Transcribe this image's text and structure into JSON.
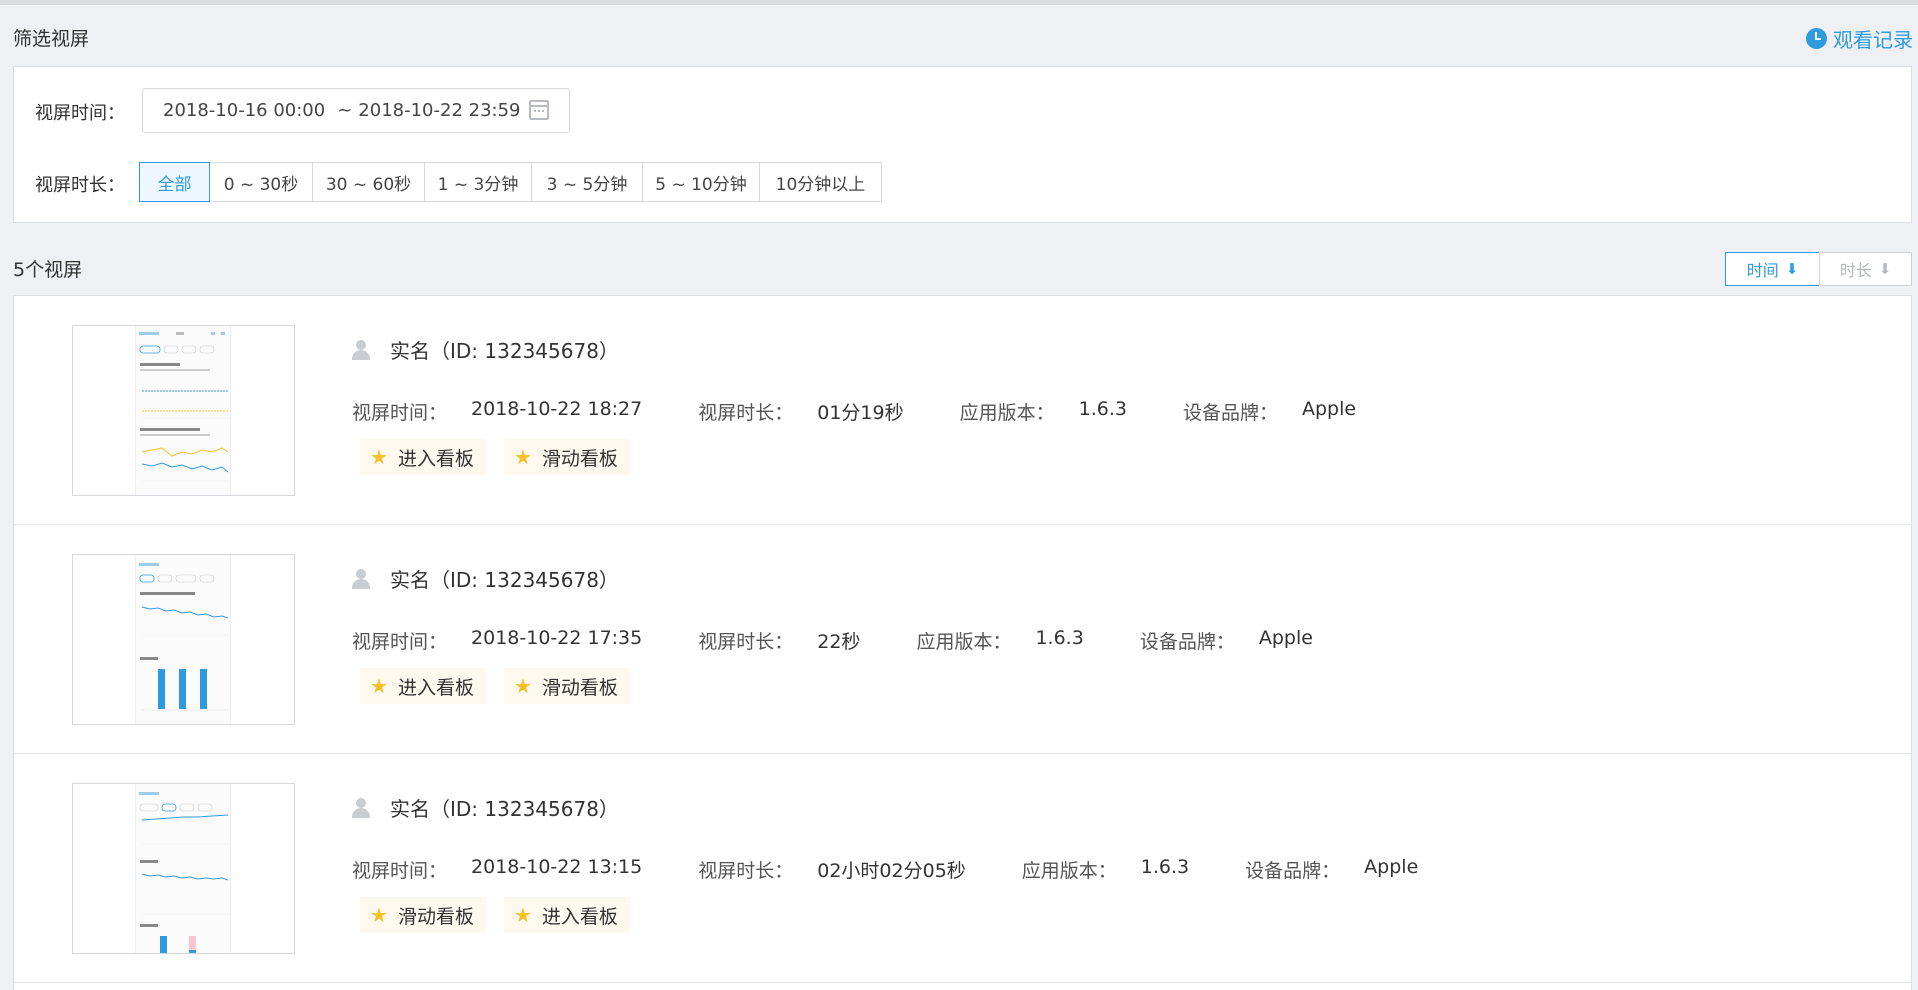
{
  "filter": {
    "title": "筛选视屏",
    "history_label": "观看记录",
    "time_label": "视屏时间：",
    "date_start": "2018-10-16 00:00",
    "date_sep": "~",
    "date_end": "2018-10-22 23:59",
    "duration_label": "视屏时长：",
    "durations": [
      "全部",
      "0 ~ 30秒",
      "30 ~ 60秒",
      "1 ~ 3分钟",
      "3 ~ 5分钟",
      "5 ~ 10分钟",
      "10分钟以上"
    ],
    "selected_duration": "全部"
  },
  "list": {
    "count_title": "5个视屏",
    "sort_time": "时间",
    "sort_duration": "时长",
    "sort_arrow": "⬇",
    "meta_keys": {
      "time": "视屏时间：",
      "duration": "视屏时长：",
      "version": "应用版本：",
      "brand": "设备品牌："
    },
    "items": [
      {
        "user": "实名（ID: 132345678）",
        "time": "2018-10-22 18:27",
        "duration": "01分19秒",
        "version": "1.6.3",
        "brand": "Apple",
        "tags": [
          "进入看板",
          "滑动看板"
        ]
      },
      {
        "user": "实名（ID: 132345678）",
        "time": "2018-10-22 17:35",
        "duration": "22秒",
        "version": "1.6.3",
        "brand": "Apple",
        "tags": [
          "进入看板",
          "滑动看板"
        ]
      },
      {
        "user": "实名（ID: 132345678）",
        "time": "2018-10-22 13:15",
        "duration": "02小时02分05秒",
        "version": "1.6.3",
        "brand": "Apple",
        "tags": [
          "滑动看板",
          "进入看板"
        ]
      }
    ]
  },
  "colors": {
    "accent": "#2f9bdf",
    "star": "#f5c025",
    "tag_bg": "#fdf9ee"
  }
}
